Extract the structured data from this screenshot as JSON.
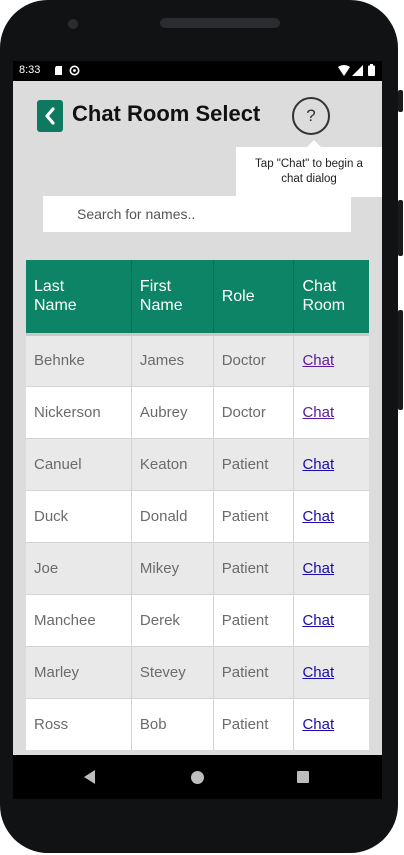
{
  "status_bar": {
    "time": "8:33"
  },
  "header": {
    "title": "Chat Room Select",
    "back_icon": "chevron-left-icon",
    "help_label": "?"
  },
  "tooltip": {
    "line1": "Tap \"Chat\" to begin a",
    "line2": "chat dialog"
  },
  "search": {
    "placeholder": "Search for names.."
  },
  "table": {
    "columns": [
      {
        "line1": "Last",
        "line2": "Name"
      },
      {
        "line1": "First",
        "line2": "Name"
      },
      {
        "line1": "Role",
        "line2": ""
      },
      {
        "line1": "Chat",
        "line2": "Room"
      }
    ],
    "rows": [
      {
        "last": "Behnke",
        "first": "James",
        "role": "Doctor",
        "chat": "Chat"
      },
      {
        "last": "Nickerson",
        "first": "Aubrey",
        "role": "Doctor",
        "chat": "Chat"
      },
      {
        "last": "Canuel",
        "first": "Keaton",
        "role": "Patient",
        "chat": "Chat"
      },
      {
        "last": "Duck",
        "first": "Donald",
        "role": "Patient",
        "chat": "Chat"
      },
      {
        "last": "Joe",
        "first": "Mikey",
        "role": "Patient",
        "chat": "Chat"
      },
      {
        "last": "Manchee",
        "first": "Derek",
        "role": "Patient",
        "chat": "Chat"
      },
      {
        "last": "Marley",
        "first": "Stevey",
        "role": "Patient",
        "chat": "Chat"
      },
      {
        "last": "Ross",
        "first": "Bob",
        "role": "Patient",
        "chat": "Chat"
      }
    ]
  },
  "colors": {
    "accent": "#0d8466",
    "back_button": "#0d7a5f",
    "link": "#1a0dab",
    "visited_link": "#5a1a9b"
  }
}
